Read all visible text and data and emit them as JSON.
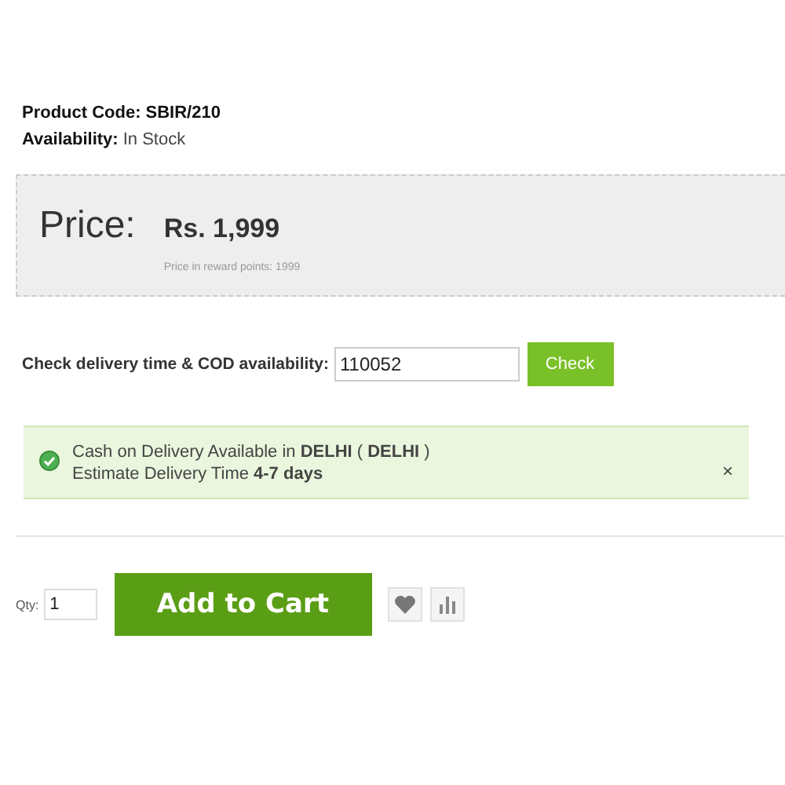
{
  "product_info": [
    {
      "label": "Product Code:",
      "value": "SBIR/210"
    },
    {
      "label": "Availability:",
      "value": "In Stock"
    }
  ],
  "price": {
    "label": "Price:",
    "value": "Rs. 1,999",
    "reward": "Price in reward points: 1999"
  },
  "delivery_check": {
    "label": "Check delivery time & COD availability:",
    "value": "110052",
    "button": "Check"
  },
  "alert": {
    "lines": [
      "Cash on Delivery Available in **DELHI** ( **DELHI** )",
      "Estimate Delivery Time **4-7 days**"
    ],
    "close": "×"
  },
  "cart": {
    "qty_label": "Qty:",
    "qty_value": "1",
    "button": "Add to Cart"
  }
}
